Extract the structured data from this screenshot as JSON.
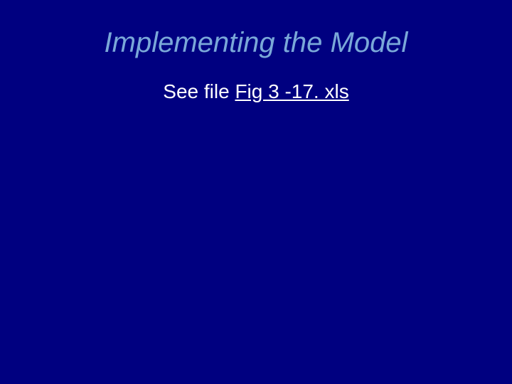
{
  "slide": {
    "title": "Implementing the Model",
    "body_prefix": "See file ",
    "file_link": "Fig 3 -17. xls"
  }
}
